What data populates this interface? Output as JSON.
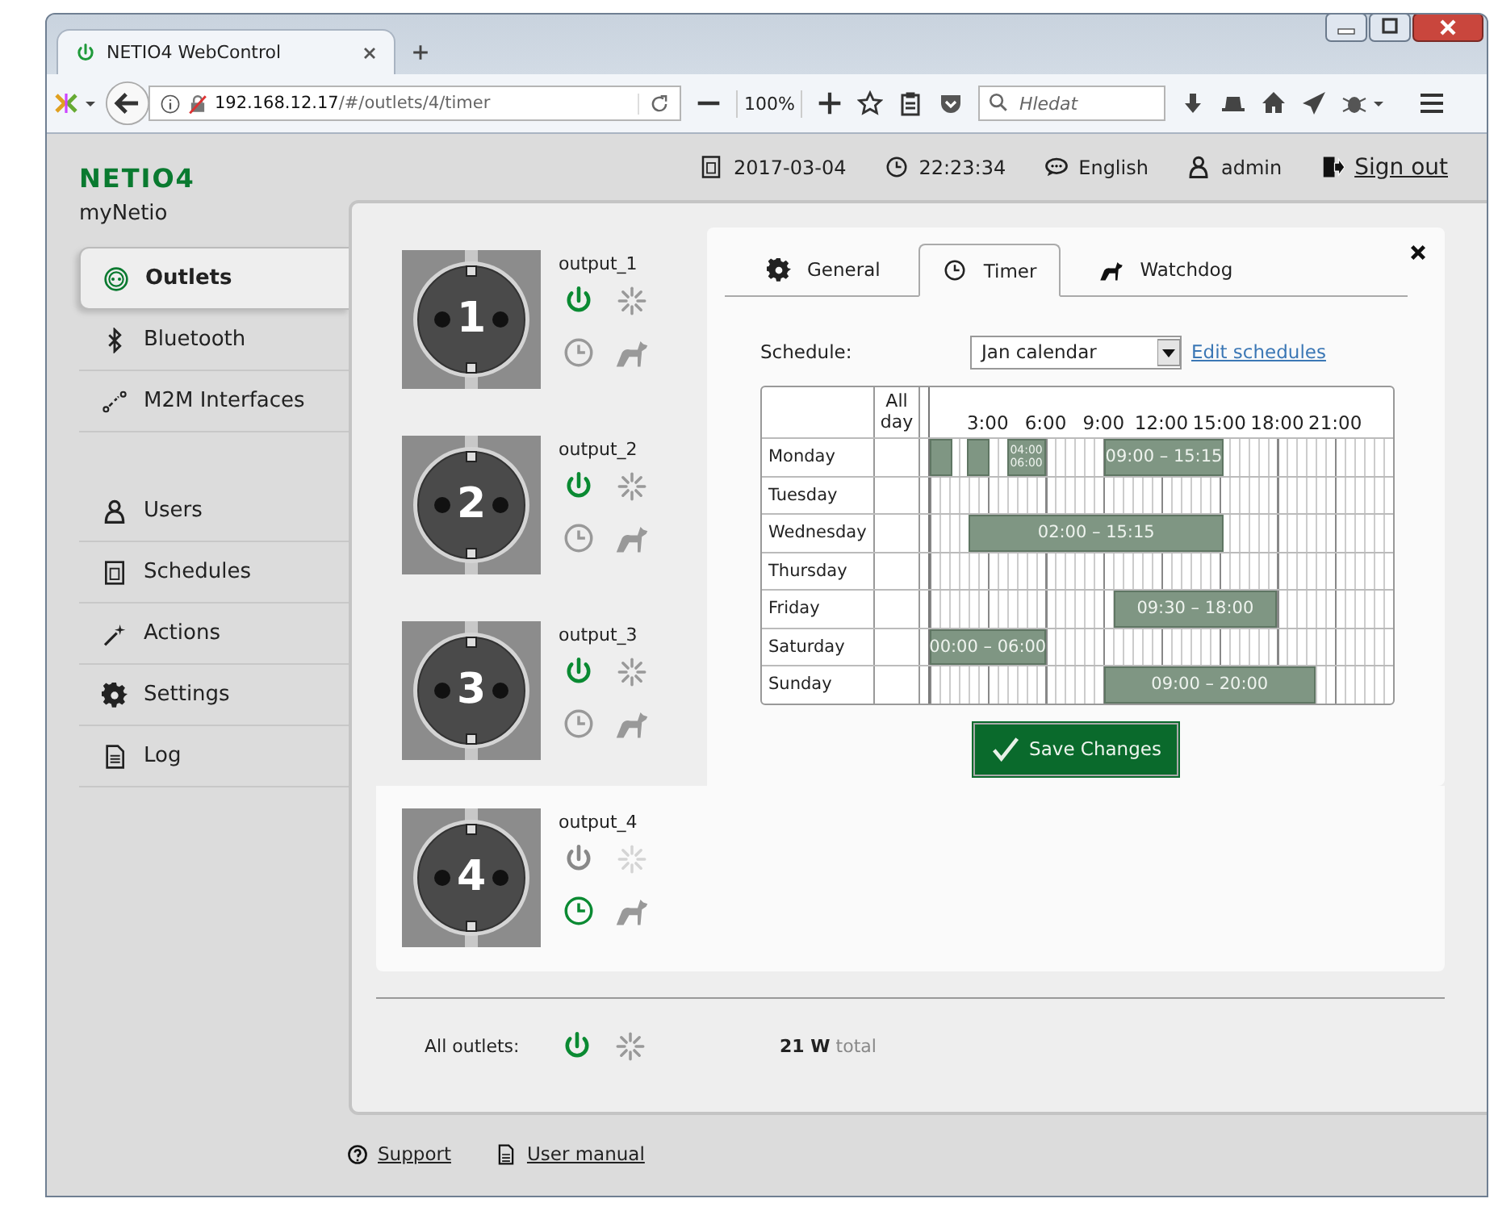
{
  "browser": {
    "tab_title": "NETIO4 WebControl",
    "url_host": "192.168.12.17",
    "url_path": "/#/outlets/4/timer",
    "zoom": "100%",
    "search": {
      "placeholder": "Hledat"
    }
  },
  "app": {
    "logo": "NETIO4",
    "device_name": "myNetio"
  },
  "header": {
    "date": "2017-03-04",
    "time": "22:23:34",
    "language": "English",
    "user": "admin",
    "sign_out": "Sign out"
  },
  "sidebar": {
    "sections": [
      {
        "items": [
          {
            "label": "Outlets",
            "kind": "outlets",
            "selected": true
          },
          {
            "label": "Bluetooth",
            "kind": "bluetooth",
            "selected": false
          },
          {
            "label": "M2M Interfaces",
            "kind": "m2m",
            "selected": false
          }
        ]
      },
      {
        "items": [
          {
            "label": "Users",
            "kind": "users",
            "selected": false
          },
          {
            "label": "Schedules",
            "kind": "schedules",
            "selected": false
          },
          {
            "label": "Actions",
            "kind": "actions",
            "selected": false
          },
          {
            "label": "Settings",
            "kind": "settings",
            "selected": false
          },
          {
            "label": "Log",
            "kind": "log",
            "selected": false
          }
        ]
      }
    ]
  },
  "outlets": [
    {
      "name": "output_1",
      "number": "1",
      "on": true,
      "timer": false,
      "selected": false
    },
    {
      "name": "output_2",
      "number": "2",
      "on": true,
      "timer": false,
      "selected": false
    },
    {
      "name": "output_3",
      "number": "3",
      "on": true,
      "timer": false,
      "selected": false
    },
    {
      "name": "output_4",
      "number": "4",
      "on": false,
      "timer": true,
      "selected": true
    }
  ],
  "detail": {
    "tabs": [
      {
        "label": "General",
        "kind": "general",
        "selected": false
      },
      {
        "label": "Timer",
        "kind": "timer",
        "selected": true
      },
      {
        "label": "Watchdog",
        "kind": "watchdog",
        "selected": false
      }
    ],
    "schedule_label": "Schedule:",
    "schedule": {
      "value": "Jan calendar"
    },
    "edit_link": "Edit schedules",
    "table": {
      "allday_heading": "All day",
      "hours": [
        "3:00",
        "6:00",
        "9:00",
        "12:00",
        "15:00",
        "18:00",
        "21:00"
      ],
      "days": [
        {
          "name": "Monday",
          "events": [
            {
              "kind": "plain"
            },
            {
              "kind": "plain"
            },
            {
              "kind": "stacked",
              "lines": [
                "04:00",
                "06:00"
              ]
            },
            {
              "kind": "labeled",
              "label": "09:00 – 15:15"
            }
          ]
        },
        {
          "name": "Tuesday"
        },
        {
          "name": "Wednesday",
          "events": [
            {
              "kind": "labeled",
              "label": "02:00 – 15:15"
            }
          ]
        },
        {
          "name": "Thursday"
        },
        {
          "name": "Friday",
          "events": [
            {
              "kind": "labeled",
              "label": "09:30 – 18:00"
            }
          ]
        },
        {
          "name": "Saturday",
          "events": [
            {
              "kind": "labeled",
              "label": "00:00 – 06:00"
            }
          ]
        },
        {
          "name": "Sunday",
          "events": [
            {
              "kind": "labeled",
              "label": "09:00 – 20:00"
            }
          ]
        }
      ]
    },
    "save_button": "Save Changes"
  },
  "all_outlets": {
    "label": "All outlets:",
    "on": true,
    "power": "**21 W** total"
  },
  "footer": {
    "links": [
      {
        "label": "Support",
        "kind": "support"
      },
      {
        "label": "User manual",
        "kind": "manual"
      }
    ]
  }
}
